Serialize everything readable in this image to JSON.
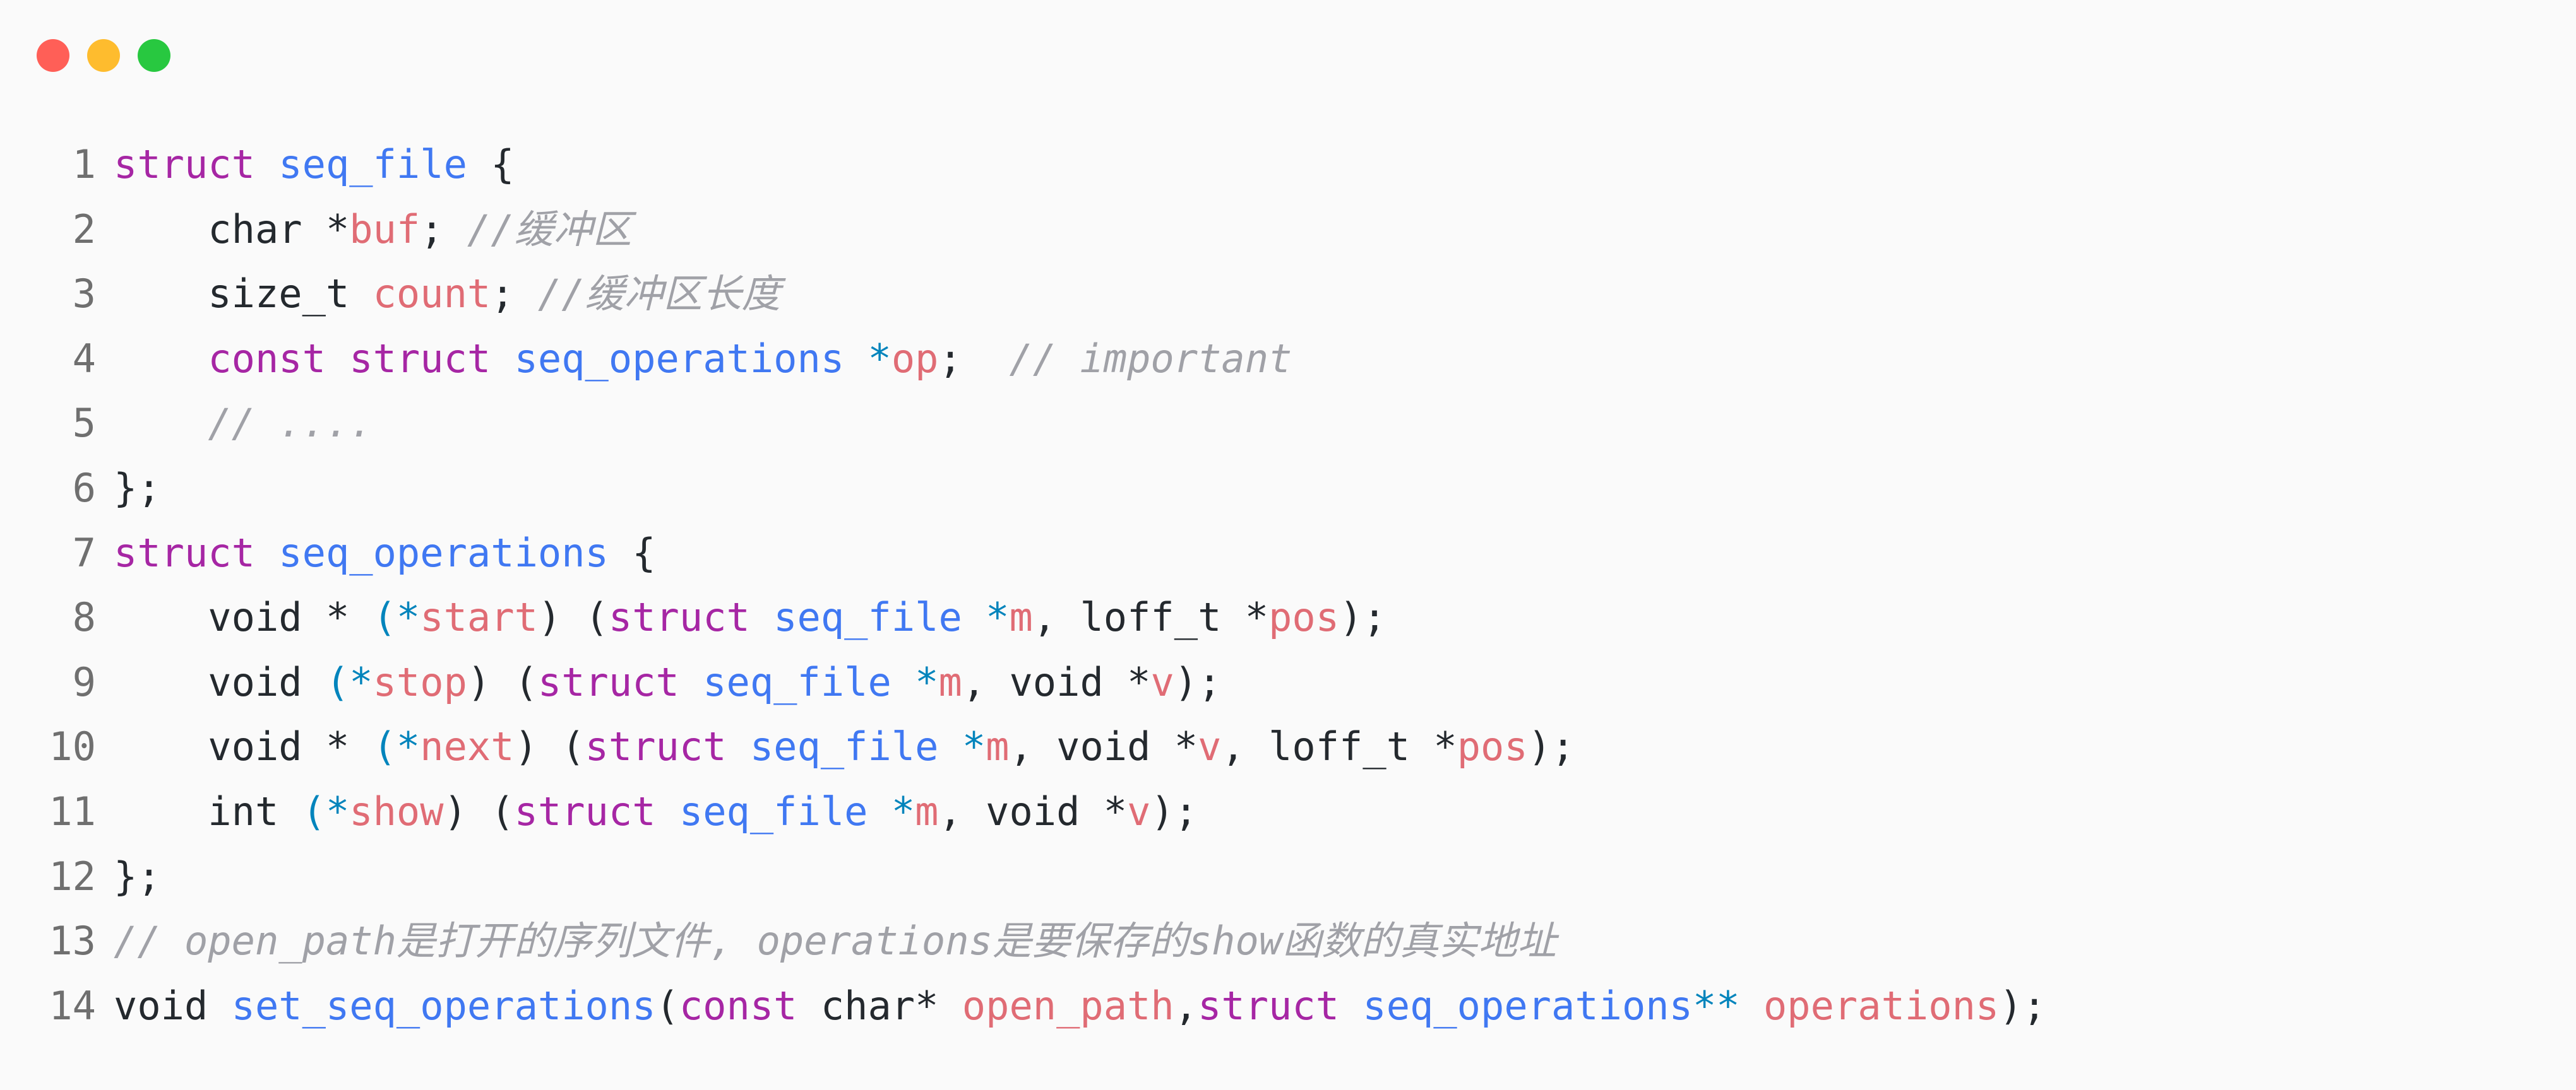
{
  "window": {
    "controls": [
      {
        "name": "close",
        "color": "#ff5f57"
      },
      {
        "name": "minimize",
        "color": "#febc2e"
      },
      {
        "name": "zoom",
        "color": "#28c840"
      }
    ]
  },
  "colors": {
    "keyword": "#a626a4",
    "type": "#4078f2",
    "variable": "#e06c75",
    "operator": "#0184bc",
    "plain": "#24292e",
    "comment": "#a0a1a7",
    "line_number": "#6f6f6f",
    "background": "#fafafa"
  },
  "code_lines": [
    {
      "number": "1",
      "tokens": [
        {
          "t": "kw",
          "v": "struct"
        },
        {
          "t": "plain",
          "v": " "
        },
        {
          "t": "type",
          "v": "seq_file"
        },
        {
          "t": "plain",
          "v": " {"
        }
      ]
    },
    {
      "number": "2",
      "tokens": [
        {
          "t": "plain",
          "v": "    char *"
        },
        {
          "t": "var",
          "v": "buf"
        },
        {
          "t": "plain",
          "v": "; "
        },
        {
          "t": "comment",
          "v": "//缓冲区"
        }
      ]
    },
    {
      "number": "3",
      "tokens": [
        {
          "t": "plain",
          "v": "    size_t "
        },
        {
          "t": "var",
          "v": "count"
        },
        {
          "t": "plain",
          "v": "; "
        },
        {
          "t": "comment",
          "v": "//缓冲区长度"
        }
      ]
    },
    {
      "number": "4",
      "tokens": [
        {
          "t": "plain",
          "v": "    "
        },
        {
          "t": "kw",
          "v": "const"
        },
        {
          "t": "plain",
          "v": " "
        },
        {
          "t": "kw",
          "v": "struct"
        },
        {
          "t": "plain",
          "v": " "
        },
        {
          "t": "type",
          "v": "seq_operations"
        },
        {
          "t": "plain",
          "v": " "
        },
        {
          "t": "op",
          "v": "*"
        },
        {
          "t": "var",
          "v": "op"
        },
        {
          "t": "plain",
          "v": ";  "
        },
        {
          "t": "comment",
          "v": "// important"
        }
      ]
    },
    {
      "number": "5",
      "tokens": [
        {
          "t": "plain",
          "v": "    "
        },
        {
          "t": "comment",
          "v": "// ...."
        }
      ]
    },
    {
      "number": "6",
      "tokens": [
        {
          "t": "plain",
          "v": "};"
        }
      ]
    },
    {
      "number": "7",
      "tokens": [
        {
          "t": "kw",
          "v": "struct"
        },
        {
          "t": "plain",
          "v": " "
        },
        {
          "t": "type",
          "v": "seq_operations"
        },
        {
          "t": "plain",
          "v": " {"
        }
      ]
    },
    {
      "number": "8",
      "tokens": [
        {
          "t": "plain",
          "v": "    void * "
        },
        {
          "t": "op",
          "v": "(*"
        },
        {
          "t": "var",
          "v": "start"
        },
        {
          "t": "plain",
          "v": ") ("
        },
        {
          "t": "kw",
          "v": "struct"
        },
        {
          "t": "plain",
          "v": " "
        },
        {
          "t": "type",
          "v": "seq_file"
        },
        {
          "t": "plain",
          "v": " "
        },
        {
          "t": "op",
          "v": "*"
        },
        {
          "t": "var",
          "v": "m"
        },
        {
          "t": "plain",
          "v": ", loff_t *"
        },
        {
          "t": "var",
          "v": "pos"
        },
        {
          "t": "plain",
          "v": ");"
        }
      ]
    },
    {
      "number": "9",
      "tokens": [
        {
          "t": "plain",
          "v": "    void "
        },
        {
          "t": "op",
          "v": "(*"
        },
        {
          "t": "var",
          "v": "stop"
        },
        {
          "t": "plain",
          "v": ") ("
        },
        {
          "t": "kw",
          "v": "struct"
        },
        {
          "t": "plain",
          "v": " "
        },
        {
          "t": "type",
          "v": "seq_file"
        },
        {
          "t": "plain",
          "v": " "
        },
        {
          "t": "op",
          "v": "*"
        },
        {
          "t": "var",
          "v": "m"
        },
        {
          "t": "plain",
          "v": ", void *"
        },
        {
          "t": "var",
          "v": "v"
        },
        {
          "t": "plain",
          "v": ");"
        }
      ]
    },
    {
      "number": "10",
      "tokens": [
        {
          "t": "plain",
          "v": "    void * "
        },
        {
          "t": "op",
          "v": "(*"
        },
        {
          "t": "var",
          "v": "next"
        },
        {
          "t": "plain",
          "v": ") ("
        },
        {
          "t": "kw",
          "v": "struct"
        },
        {
          "t": "plain",
          "v": " "
        },
        {
          "t": "type",
          "v": "seq_file"
        },
        {
          "t": "plain",
          "v": " "
        },
        {
          "t": "op",
          "v": "*"
        },
        {
          "t": "var",
          "v": "m"
        },
        {
          "t": "plain",
          "v": ", void *"
        },
        {
          "t": "var",
          "v": "v"
        },
        {
          "t": "plain",
          "v": ", loff_t *"
        },
        {
          "t": "var",
          "v": "pos"
        },
        {
          "t": "plain",
          "v": ");"
        }
      ]
    },
    {
      "number": "11",
      "tokens": [
        {
          "t": "plain",
          "v": "    int "
        },
        {
          "t": "op",
          "v": "(*"
        },
        {
          "t": "var",
          "v": "show"
        },
        {
          "t": "plain",
          "v": ") ("
        },
        {
          "t": "kw",
          "v": "struct"
        },
        {
          "t": "plain",
          "v": " "
        },
        {
          "t": "type",
          "v": "seq_file"
        },
        {
          "t": "plain",
          "v": " "
        },
        {
          "t": "op",
          "v": "*"
        },
        {
          "t": "var",
          "v": "m"
        },
        {
          "t": "plain",
          "v": ", void *"
        },
        {
          "t": "var",
          "v": "v"
        },
        {
          "t": "plain",
          "v": ");"
        }
      ]
    },
    {
      "number": "12",
      "tokens": [
        {
          "t": "plain",
          "v": "};"
        }
      ]
    },
    {
      "number": "13",
      "tokens": [
        {
          "t": "comment",
          "v": "// open_path是打开的序列文件, operations是要保存的show函数的真实地址"
        }
      ]
    },
    {
      "number": "14",
      "tokens": [
        {
          "t": "plain",
          "v": "void "
        },
        {
          "t": "type",
          "v": "set_seq_operations"
        },
        {
          "t": "plain",
          "v": "("
        },
        {
          "t": "kw",
          "v": "const"
        },
        {
          "t": "plain",
          "v": " char* "
        },
        {
          "t": "var",
          "v": "open_path"
        },
        {
          "t": "plain",
          "v": ","
        },
        {
          "t": "kw",
          "v": "struct"
        },
        {
          "t": "plain",
          "v": " "
        },
        {
          "t": "type",
          "v": "seq_operations"
        },
        {
          "t": "op",
          "v": "**"
        },
        {
          "t": "plain",
          "v": " "
        },
        {
          "t": "var",
          "v": "operations"
        },
        {
          "t": "plain",
          "v": ");"
        }
      ]
    }
  ]
}
